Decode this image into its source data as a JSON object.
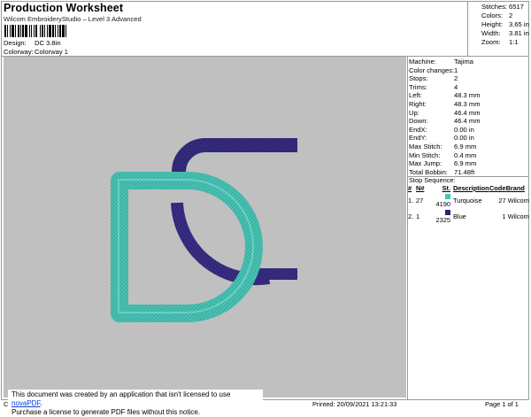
{
  "header": {
    "title": "Production Worksheet",
    "subtitle": "Wilcom EmbroideryStudio – Level 3 Advanced",
    "design_label": "Design:",
    "design_value": "DC 3.8in",
    "colorway_label": "Colorway:",
    "colorway_value": "Colorway 1"
  },
  "summary": [
    {
      "label": "Stitches:",
      "value": "6517"
    },
    {
      "label": "Colors:",
      "value": "2"
    },
    {
      "label": "Height:",
      "value": "3.65 in"
    },
    {
      "label": "Width:",
      "value": "3.81 in"
    },
    {
      "label": "Zoom:",
      "value": "1:1"
    }
  ],
  "machine_info": [
    {
      "label": "Machine:",
      "value": "Tajima"
    },
    {
      "label": "Color changes:",
      "value": "1"
    },
    {
      "label": "Stops:",
      "value": "2"
    },
    {
      "label": "Trims:",
      "value": "4"
    },
    {
      "label": "Left:",
      "value": "48.3 mm"
    },
    {
      "label": "Right:",
      "value": "48.3 mm"
    },
    {
      "label": "Up:",
      "value": "46.4 mm"
    },
    {
      "label": "Down:",
      "value": "46.4 mm"
    },
    {
      "label": "EndX:",
      "value": "0.00 in"
    },
    {
      "label": "EndY:",
      "value": "0.00 in"
    },
    {
      "label": "Max Stitch:",
      "value": "6.9 mm"
    },
    {
      "label": "Min Stitch:",
      "value": "0.4 mm"
    },
    {
      "label": "Max Jump:",
      "value": "6.9 mm"
    },
    {
      "label": "Total Bobbin:",
      "value": "71.48ft"
    }
  ],
  "stop_sequence": {
    "title": "Stop Sequence:",
    "columns": [
      "#",
      "N#",
      "St.",
      "Description",
      "Code",
      "Brand"
    ],
    "rows": [
      {
        "num": "1.",
        "n": "27",
        "st": "4190",
        "color": "#3fc7bb",
        "description": "Turquoise",
        "code": "27",
        "brand": "Wilcom"
      },
      {
        "num": "2.",
        "n": "1",
        "st": "2325",
        "color": "#2b237a",
        "description": "Blue",
        "code": "1",
        "brand": "Wilcom"
      }
    ]
  },
  "design_colors": {
    "turquoise": "#49c2b4",
    "blue": "#3a2f86",
    "background": "#c0c0c0"
  },
  "footer": {
    "left": "Cr",
    "printed": "Printed: 20/09/2021 13:21:33",
    "page": "Page 1 of 1"
  },
  "notice": {
    "line1_prefix": "This document was created by an application that isn't licensed to use ",
    "link": "novaPDF",
    "line1_suffix": ".",
    "line2": "Purchase a license to generate PDF files without this notice."
  }
}
